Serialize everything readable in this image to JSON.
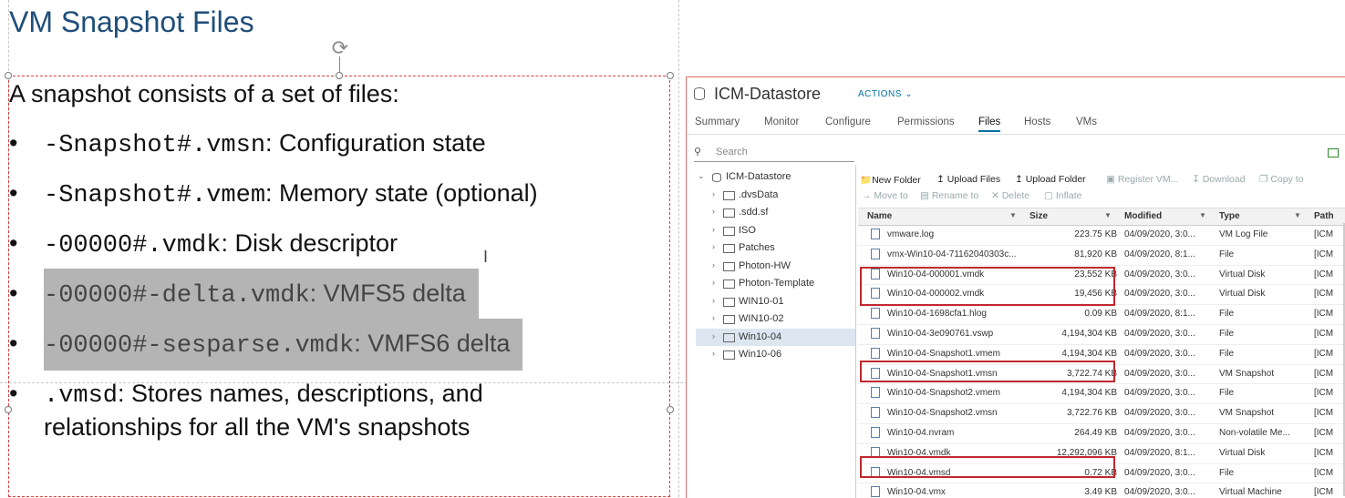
{
  "slide": {
    "title": "VM Snapshot Files",
    "intro": "A snapshot consists of a set of files:",
    "bullets": [
      {
        "code": "-Snapshot#.vmsn",
        "desc": ": Configuration state"
      },
      {
        "code": "-Snapshot#.vmem",
        "desc": ": Memory state (optional)"
      },
      {
        "code": "-00000#.vmdk",
        "desc": ": Disk descriptor"
      },
      {
        "code": "-00000#-delta.vmdk",
        "desc": ": VMFS5 delta"
      },
      {
        "code": "-00000#-sesparse.vmdk",
        "desc": ": VMFS6 delta"
      },
      {
        "code": ".vmsd",
        "desc": ": Stores names, descriptions, and relationships for all the VM's snapshots"
      }
    ],
    "bullet_char": "•"
  },
  "vsphere": {
    "datastore_name": "ICM-Datastore",
    "actions_label": "ACTIONS ⌄",
    "tabs": [
      "Summary",
      "Monitor",
      "Configure",
      "Permissions",
      "Files",
      "Hosts",
      "VMs"
    ],
    "active_tab": "Files",
    "search_placeholder": "Search",
    "tree": [
      {
        "label": "ICM-Datastore",
        "chev": "⌄"
      },
      {
        "label": ".dvsData",
        "chev": "›"
      },
      {
        "label": ".sdd.sf",
        "chev": "›"
      },
      {
        "label": "ISO",
        "chev": "›"
      },
      {
        "label": "Patches",
        "chev": "›"
      },
      {
        "label": "Photon-HW",
        "chev": "›"
      },
      {
        "label": "Photon-Template",
        "chev": "›"
      },
      {
        "label": "WIN10-01",
        "chev": "›"
      },
      {
        "label": "WIN10-02",
        "chev": "›"
      },
      {
        "label": "Win10-04",
        "chev": "›"
      },
      {
        "label": "Win10-06",
        "chev": "›"
      }
    ],
    "toolbar": {
      "new_folder": "New Folder",
      "upload_files": "Upload Files",
      "upload_folder": "Upload Folder",
      "register_vm": "Register VM...",
      "download": "Download",
      "copy_to": "Copy to",
      "move_to": "Move to",
      "rename_to": "Rename to",
      "delete": "Delete",
      "inflate": "Inflate"
    },
    "columns": [
      "Name",
      "Size",
      "Modified",
      "Type",
      "Path"
    ],
    "files": [
      {
        "name": "vmware.log",
        "size": "223.75 KB",
        "modified": "04/09/2020, 3:0...",
        "type": "VM Log File",
        "path": "[ICM"
      },
      {
        "name": "vmx-Win10-04-71162040303c...",
        "size": "81,920 KB",
        "modified": "04/09/2020, 8:1...",
        "type": "File",
        "path": "[ICM"
      },
      {
        "name": "Win10-04-000001.vmdk",
        "size": "23,552 KB",
        "modified": "04/09/2020, 3:0...",
        "type": "Virtual Disk",
        "path": "[ICM"
      },
      {
        "name": "Win10-04-000002.vmdk",
        "size": "19,456 KB",
        "modified": "04/09/2020, 3:0...",
        "type": "Virtual Disk",
        "path": "[ICM"
      },
      {
        "name": "Win10-04-1698cfa1.hlog",
        "size": "0.09 KB",
        "modified": "04/09/2020, 8:1...",
        "type": "File",
        "path": "[ICM"
      },
      {
        "name": "Win10-04-3e090761.vswp",
        "size": "4,194,304 KB",
        "modified": "04/09/2020, 3:0...",
        "type": "File",
        "path": "[ICM"
      },
      {
        "name": "Win10-04-Snapshot1.vmem",
        "size": "4,194,304 KB",
        "modified": "04/09/2020, 3:0...",
        "type": "File",
        "path": "[ICM"
      },
      {
        "name": "Win10-04-Snapshot1.vmsn",
        "size": "3,722.74 KB",
        "modified": "04/09/2020, 3:0...",
        "type": "VM Snapshot",
        "path": "[ICM"
      },
      {
        "name": "Win10-04-Snapshot2.vmem",
        "size": "4,194,304 KB",
        "modified": "04/09/2020, 3:0...",
        "type": "File",
        "path": "[ICM"
      },
      {
        "name": "Win10-04-Snapshot2.vmsn",
        "size": "3,722.76 KB",
        "modified": "04/09/2020, 3:0...",
        "type": "VM Snapshot",
        "path": "[ICM"
      },
      {
        "name": "Win10-04.nvram",
        "size": "264.49 KB",
        "modified": "04/09/2020, 3:0...",
        "type": "Non-volatile Me...",
        "path": "[ICM"
      },
      {
        "name": "Win10-04.vmdk",
        "size": "12,292,096 KB",
        "modified": "04/09/2020, 8:1...",
        "type": "Virtual Disk",
        "path": "[ICM"
      },
      {
        "name": "Win10-04.vmsd",
        "size": "0.72 KB",
        "modified": "04/09/2020, 3:0...",
        "type": "File",
        "path": "[ICM"
      },
      {
        "name": "Win10-04.vmx",
        "size": "3.49 KB",
        "modified": "04/09/2020, 3:0...",
        "type": "Virtual Machine",
        "path": "[ICM"
      }
    ]
  }
}
